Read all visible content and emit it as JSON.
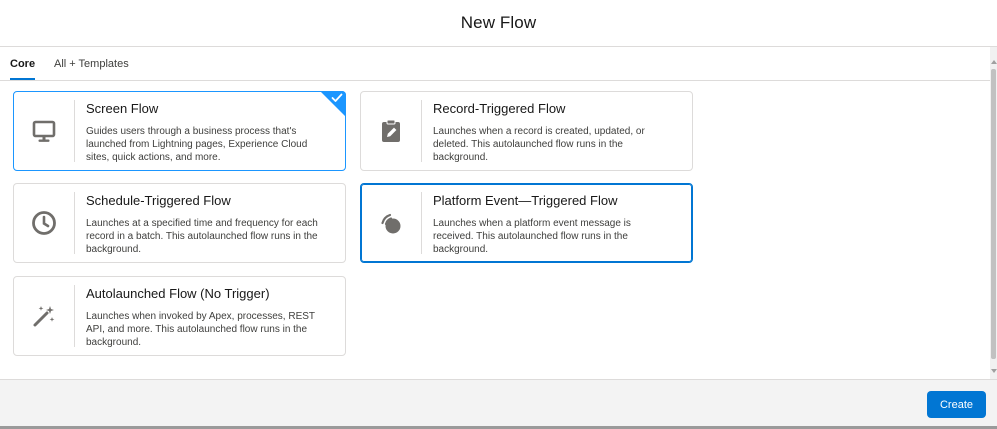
{
  "modal": {
    "title": "New Flow"
  },
  "tabs": [
    {
      "label": "Core",
      "active": true
    },
    {
      "label": "All + Templates",
      "active": false
    }
  ],
  "cards": [
    {
      "title": "Screen Flow",
      "description": "Guides users through a business process that's launched from Lightning pages, Experience Cloud sites, quick actions, and more.",
      "icon": "monitor-icon",
      "selected": true
    },
    {
      "title": "Record-Triggered Flow",
      "description": "Launches when a record is created, updated, or deleted. This autolaunched flow runs in the background.",
      "icon": "clipboard-edit-icon",
      "selected": false
    },
    {
      "title": "Schedule-Triggered Flow",
      "description": "Launches at a specified time and frequency for each record in a batch. This autolaunched flow runs in the background.",
      "icon": "clock-icon",
      "selected": false
    },
    {
      "title": "Platform Event—Triggered Flow",
      "description": "Launches when a platform event message is received. This autolaunched flow runs in the background.",
      "icon": "signal-event-icon",
      "selected": false
    },
    {
      "title": "Autolaunched Flow (No Trigger)",
      "description": "Launches when invoked by Apex, processes, REST API, and more. This autolaunched flow runs in the background.",
      "icon": "magic-wand-icon",
      "selected": false
    }
  ],
  "footer": {
    "create_label": "Create"
  },
  "colors": {
    "brand": "#0176d3",
    "selected_border": "#1b96ff",
    "icon": "#706e6b"
  }
}
